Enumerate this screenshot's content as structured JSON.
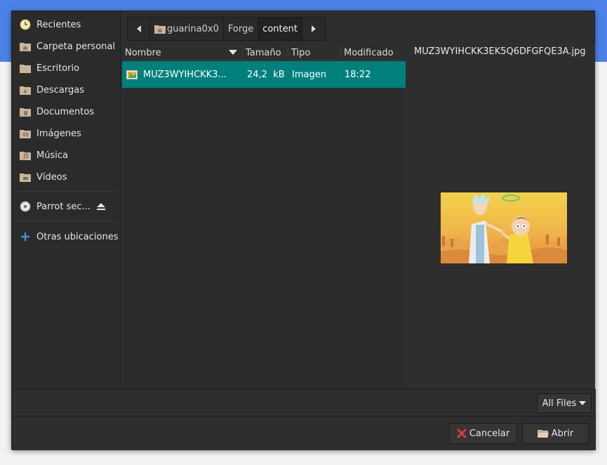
{
  "sidebar": {
    "places": [
      {
        "label": "Recientes",
        "icon": "recent-icon"
      },
      {
        "label": "Carpeta personal",
        "icon": "home-folder-icon"
      },
      {
        "label": "Escritorio",
        "icon": "folder-icon"
      },
      {
        "label": "Descargas",
        "icon": "downloads-folder-icon"
      },
      {
        "label": "Documentos",
        "icon": "documents-folder-icon"
      },
      {
        "label": "Imágenes",
        "icon": "pictures-folder-icon"
      },
      {
        "label": "Música",
        "icon": "music-folder-icon"
      },
      {
        "label": "Vídeos",
        "icon": "videos-folder-icon"
      }
    ],
    "device": {
      "label": "Parrot sec...",
      "icon": "disc-icon"
    },
    "other": {
      "label": "Otras ubicaciones",
      "icon": "plus-icon"
    }
  },
  "pathbar": {
    "segments": [
      "guarina0x0",
      "Forge",
      "content"
    ],
    "active_index": 2
  },
  "filelist": {
    "columns": [
      "Nombre",
      "Tamaño",
      "Tipo",
      "Modificado"
    ],
    "rows": [
      {
        "name": "MUZ3WYIHCKK3...",
        "size": "24,2  kB",
        "type": "Imagen",
        "modified": "18:22",
        "selected": true
      }
    ]
  },
  "preview": {
    "filename": "MUZ3WYIHCKK3EK5Q6DFGFQE3A.jpg"
  },
  "filter": {
    "label": "All Files"
  },
  "actions": {
    "cancel_label": "Cancelar",
    "open_label": "Abrir"
  },
  "colors": {
    "selection": "#00807c",
    "accent_bg": "#4c82e8"
  }
}
